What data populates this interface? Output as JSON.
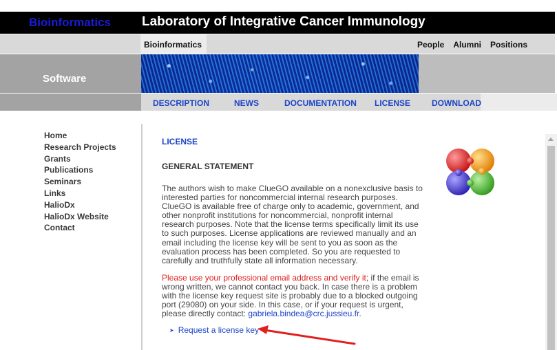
{
  "header": {
    "brand": "Bioinformatics",
    "title": "Laboratory of Integrative Cancer Immunology"
  },
  "subnav": {
    "breadcrumb": "Bioinformatics",
    "links": [
      "People",
      "Alumni",
      "Positions"
    ]
  },
  "banner": {
    "section": "Software"
  },
  "tabs": [
    "DESCRIPTION",
    "NEWS",
    "DOCUMENTATION",
    "LICENSE",
    "DOWNLOAD"
  ],
  "active_tab": "LICENSE",
  "sidebar": {
    "items": [
      "Home",
      "Research Projects",
      "Grants",
      "Publications",
      "Seminars",
      "Links",
      "HalioDx",
      "HalioDx Website",
      "Contact"
    ]
  },
  "content": {
    "heading": "LICENSE",
    "subheading": "GENERAL STATEMENT",
    "paragraph1": "The authors wish to make ClueGO available on a nonexclusive basis to interested parties for noncommercial internal research purposes. ClueGO is available free of charge only to academic, government, and other nonprofit institutions for noncommercial, nonprofit internal research purposes. Note that the license terms specifically limit its use to such purposes. License applications are reviewed manually and an email including the license key will be sent to you as soon as the evaluation process has been completed. So you are requested to carefully and truthfully state all information necessary.",
    "warning": "Please use your professional email address and verify it;",
    "paragraph2": " if the email is wrong written, we cannot contact you back. In case there is a problem with the license key request site is probably due to a blocked outgoing port (29080) on your side. In this case, or if your request is urgent, please directly contact: ",
    "email": "gabriela.bindea@crc.jussieu.fr",
    "after_email": ".",
    "request_link": "Request a license key"
  },
  "colors": {
    "link_blue": "#1c44c8",
    "warning_red": "#e0201e",
    "annotation_arrow": "#e0201e"
  }
}
